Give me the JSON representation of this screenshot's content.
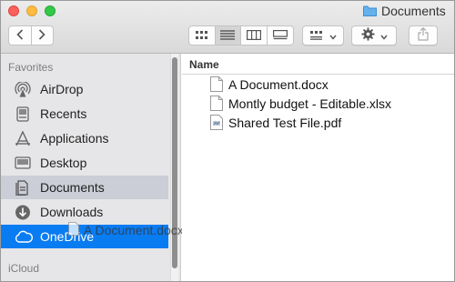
{
  "window": {
    "title": "Documents"
  },
  "toolbar": {
    "back_icon": "chevron-left-icon",
    "forward_icon": "chevron-right-icon",
    "view_modes": [
      "icon-view-icon",
      "list-view-icon",
      "column-view-icon",
      "gallery-view-icon"
    ],
    "active_view": "list",
    "group_icon": "group-by-icon",
    "action_icon": "gear-icon",
    "share_icon": "share-icon"
  },
  "sidebar": {
    "favorites_header": "Favorites",
    "items": [
      {
        "label": "AirDrop",
        "icon": "airdrop-icon"
      },
      {
        "label": "Recents",
        "icon": "recents-icon"
      },
      {
        "label": "Applications",
        "icon": "applications-icon"
      },
      {
        "label": "Desktop",
        "icon": "desktop-icon"
      },
      {
        "label": "Documents",
        "icon": "documents-icon",
        "selected": true
      },
      {
        "label": "Downloads",
        "icon": "downloads-icon"
      },
      {
        "label": "OneDrive",
        "icon": "cloud-icon",
        "drop_target": true
      }
    ],
    "icloud_header": "iCloud"
  },
  "drag": {
    "label": "A Document.docx",
    "icon": "document-icon"
  },
  "main": {
    "column_header": "Name",
    "files": [
      {
        "name": "A Document.docx",
        "icon": "document-icon"
      },
      {
        "name": "Montly budget - Editable.xlsx",
        "icon": "document-icon"
      },
      {
        "name": "Shared Test File.pdf",
        "icon": "pdf-icon"
      }
    ]
  },
  "colors": {
    "accent": "#0a7cf2",
    "sidebar_bg": "#e6e6e8",
    "selection": "#cbced6"
  }
}
